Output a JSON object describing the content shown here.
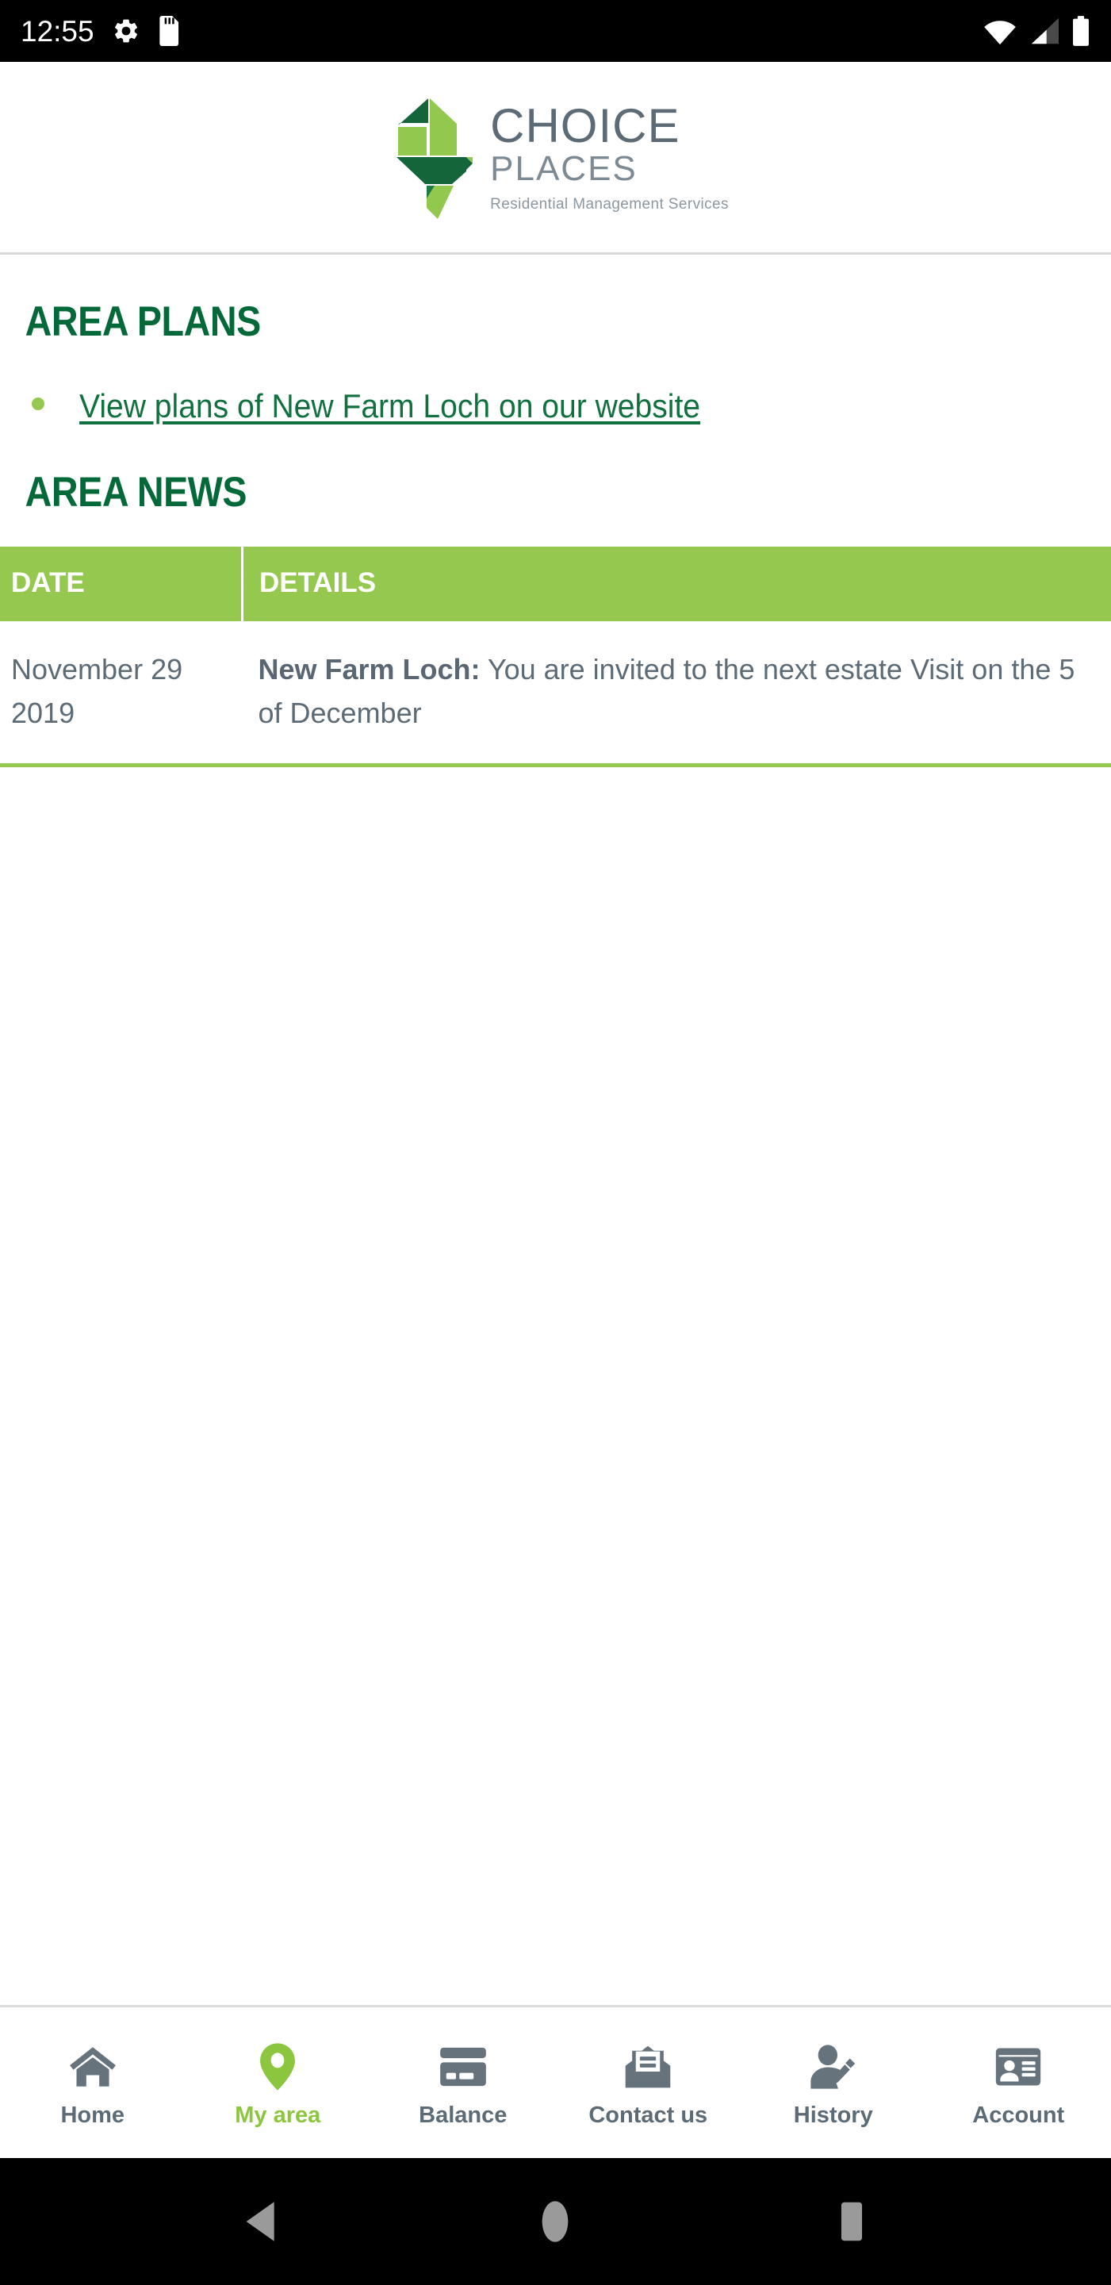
{
  "status_bar": {
    "time": "12:55",
    "left_icons": [
      "gear-icon",
      "sd-card-icon"
    ],
    "right_icons": [
      "wifi-icon",
      "cellular-signal-icon",
      "battery-icon"
    ]
  },
  "header": {
    "logo_mark": "choice-places-logo-mark",
    "brand_line1": "CHOICE",
    "brand_line2": "PLACES",
    "tagline": "Residential Management Services"
  },
  "main": {
    "area_plans": {
      "heading": "AREA PLANS",
      "links": [
        {
          "label": "View plans of New Farm Loch on our website"
        }
      ]
    },
    "area_news": {
      "heading": "AREA NEWS",
      "table": {
        "columns": [
          "DATE",
          "DETAILS"
        ],
        "rows": [
          {
            "date": "November 29 2019",
            "detail_lead": "New Farm Loch:",
            "detail_text": " You are invited to the next estate Visit on the 5 of December"
          }
        ]
      }
    }
  },
  "bottom_nav": {
    "items": [
      {
        "label": "Home",
        "icon": "house-icon",
        "active": false
      },
      {
        "label": "My area",
        "icon": "map-pin-icon",
        "active": true
      },
      {
        "label": "Balance",
        "icon": "credit-card-icon",
        "active": false
      },
      {
        "label": "Contact us",
        "icon": "open-envelope-icon",
        "active": false
      },
      {
        "label": "History",
        "icon": "person-pencil-icon",
        "active": false
      },
      {
        "label": "Account",
        "icon": "id-card-icon",
        "active": false
      }
    ]
  },
  "system_nav": {
    "back": "back-triangle-icon",
    "home": "home-circle-icon",
    "recents": "recents-square-icon"
  },
  "colors": {
    "brand_dark_green": "#046938",
    "brand_light_green": "#95c84e",
    "link_green": "#10713f",
    "text_grey": "#5d6b76",
    "logo_grey": "#5d6b76"
  }
}
